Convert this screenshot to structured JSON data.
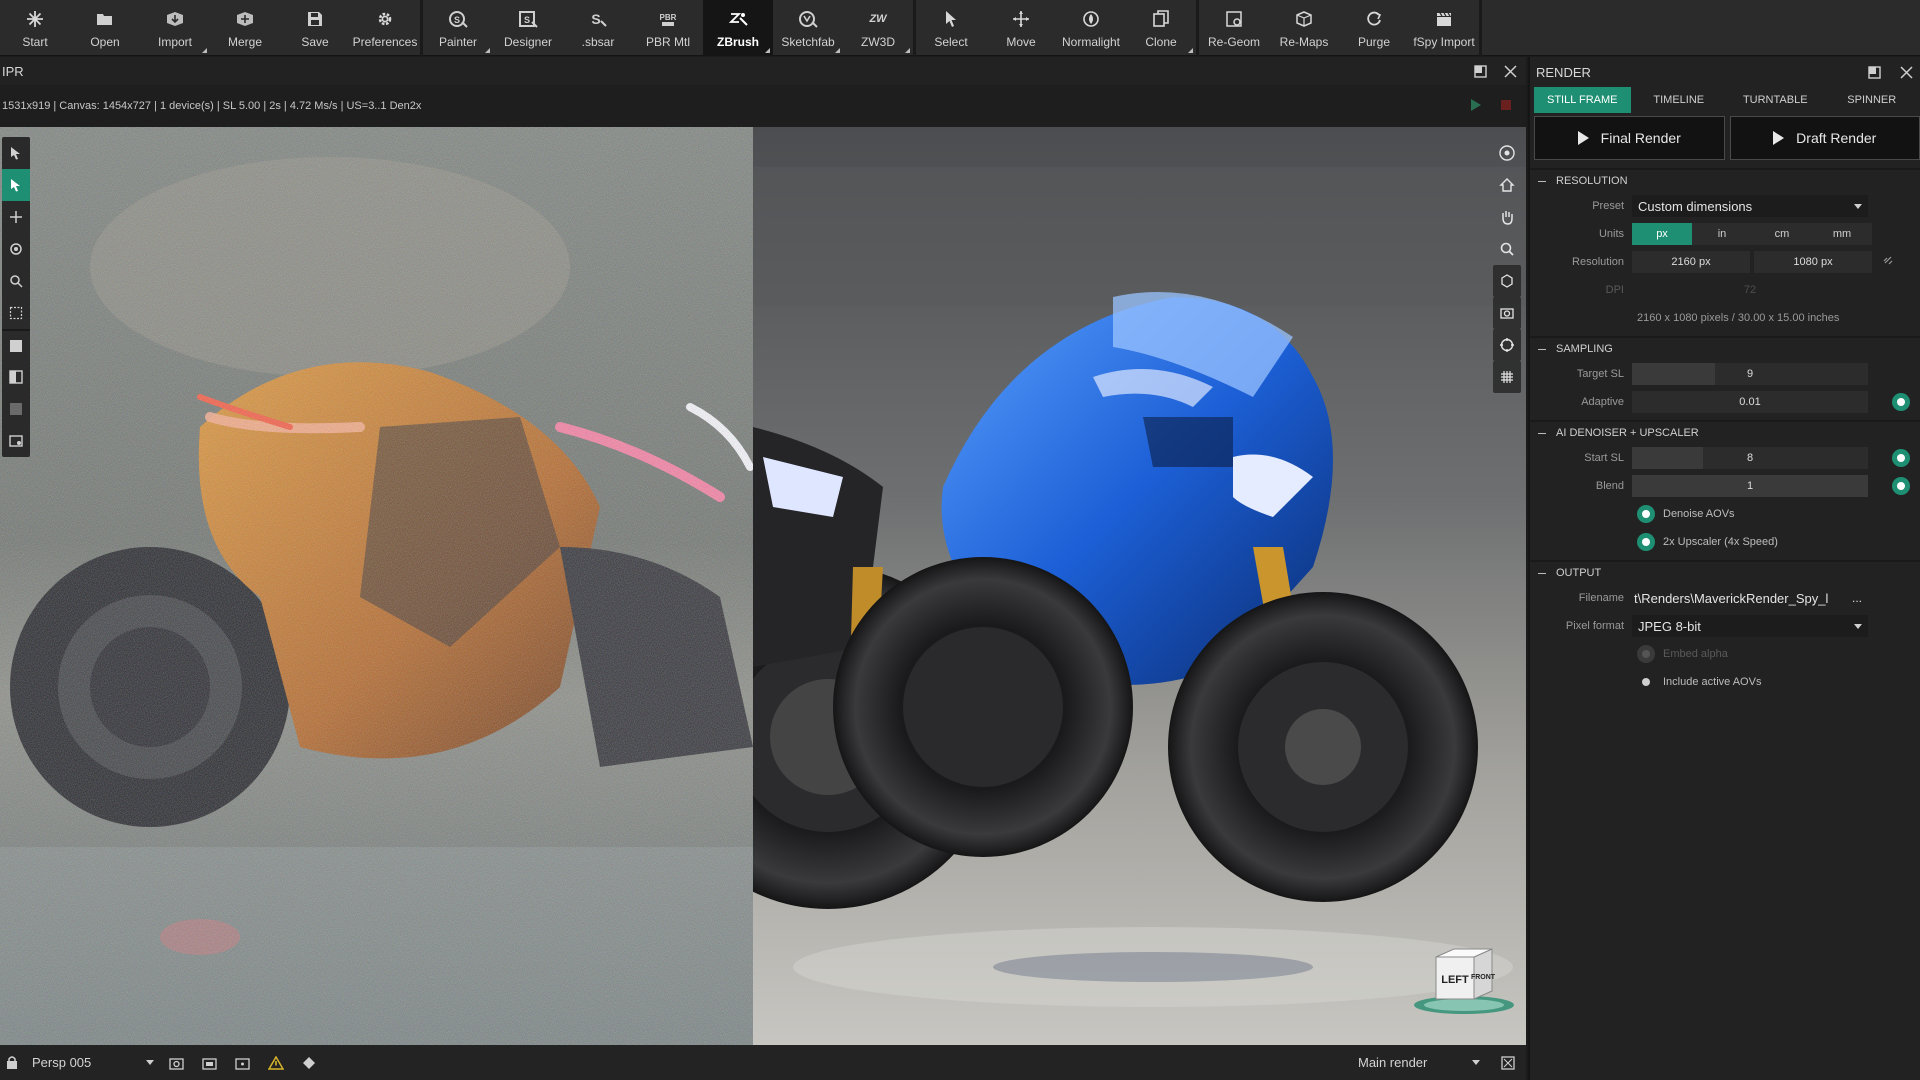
{
  "toolbar": {
    "groups": [
      [
        {
          "id": "start",
          "label": "Start",
          "icon": "star-icon"
        },
        {
          "id": "open",
          "label": "Open",
          "icon": "folder-open-icon"
        },
        {
          "id": "import",
          "label": "Import",
          "icon": "import-icon",
          "dropdown": true
        },
        {
          "id": "merge",
          "label": "Merge",
          "icon": "merge-icon"
        },
        {
          "id": "save",
          "label": "Save",
          "icon": "save-icon"
        },
        {
          "id": "preferences",
          "label": "Preferences",
          "icon": "gear-icon"
        }
      ],
      [
        {
          "id": "painter",
          "label": "Painter",
          "icon": "painter-icon",
          "dropdown": true
        },
        {
          "id": "designer",
          "label": "Designer",
          "icon": "designer-icon"
        },
        {
          "id": "sbsar",
          "label": ".sbsar",
          "icon": "sbsar-icon"
        },
        {
          "id": "pbr-mtl",
          "label": "PBR Mtl",
          "icon": "pbr-icon"
        },
        {
          "id": "zbrush",
          "label": "ZBrush",
          "icon": "zbrush-icon",
          "dropdown": true,
          "active": true
        },
        {
          "id": "sketchfab",
          "label": "Sketchfab",
          "icon": "sketchfab-icon",
          "dropdown": true
        },
        {
          "id": "zw3d",
          "label": "ZW3D",
          "icon": "zw3d-icon",
          "dropdown": true
        }
      ],
      [
        {
          "id": "select",
          "label": "Select",
          "icon": "cursor-icon"
        },
        {
          "id": "move",
          "label": "Move",
          "icon": "move-icon"
        },
        {
          "id": "normalight",
          "label": "Normalight",
          "icon": "normalight-icon"
        },
        {
          "id": "clone",
          "label": "Clone",
          "icon": "clone-icon",
          "dropdown": true
        }
      ],
      [
        {
          "id": "re-geom",
          "label": "Re-Geom",
          "icon": "regeom-icon"
        },
        {
          "id": "re-maps",
          "label": "Re-Maps",
          "icon": "remaps-icon"
        },
        {
          "id": "purge",
          "label": "Purge",
          "icon": "purge-icon"
        },
        {
          "id": "fspy-import",
          "label": "fSpy Import",
          "icon": "clapper-icon"
        }
      ]
    ]
  },
  "ipr": {
    "title": "IPR",
    "stats": "1531x919  |  Canvas: 1454x727  |  1 device(s)  |  SL 5.00  |  2s  |  4.72 Ms/s  |  US=3..1 Den2x",
    "camera": "Persp 005",
    "render_target": "Main render",
    "nav_cube": {
      "left": "LEFT",
      "front": "FRONT"
    }
  },
  "render_panel": {
    "title": "RENDER",
    "tabs": [
      "STILL FRAME",
      "TIMELINE",
      "TURNTABLE",
      "SPINNER"
    ],
    "active_tab": "STILL FRAME",
    "final_render": "Final Render",
    "draft_render": "Draft Render",
    "resolution": {
      "header": "RESOLUTION",
      "preset_label": "Preset",
      "preset": "Custom dimensions",
      "units_label": "Units",
      "units": [
        "px",
        "in",
        "cm",
        "mm"
      ],
      "active_unit": "px",
      "resolution_label": "Resolution",
      "width": "2160 px",
      "height": "1080 px",
      "dpi_label": "DPI",
      "dpi": "72",
      "info": "2160 x 1080 pixels  /  30.00 x 15.00 inches"
    },
    "sampling": {
      "header": "SAMPLING",
      "target_sl_label": "Target SL",
      "target_sl": "9",
      "target_sl_fill": 0.35,
      "adaptive_label": "Adaptive",
      "adaptive": "0.01",
      "adaptive_fill": 0.0
    },
    "denoiser": {
      "header": "AI DENOISER + UPSCALER",
      "start_sl_label": "Start SL",
      "start_sl": "8",
      "start_sl_fill": 0.3,
      "blend_label": "Blend",
      "blend": "1",
      "blend_fill": 1.0,
      "denoise_aovs": "Denoise AOVs",
      "upscaler": "2x Upscaler (4x Speed)"
    },
    "output": {
      "header": "OUTPUT",
      "filename_label": "Filename",
      "filename": "t\\Renders\\MaverickRender_Spy_l",
      "more": "...",
      "pixel_format_label": "Pixel format",
      "pixel_format": "JPEG 8-bit",
      "embed_alpha": "Embed alpha",
      "include_aovs": "Include active AOVs"
    }
  },
  "colors": {
    "accent": "#1e8f72",
    "panel": "#222222",
    "toolbar": "#2b2b2b"
  }
}
